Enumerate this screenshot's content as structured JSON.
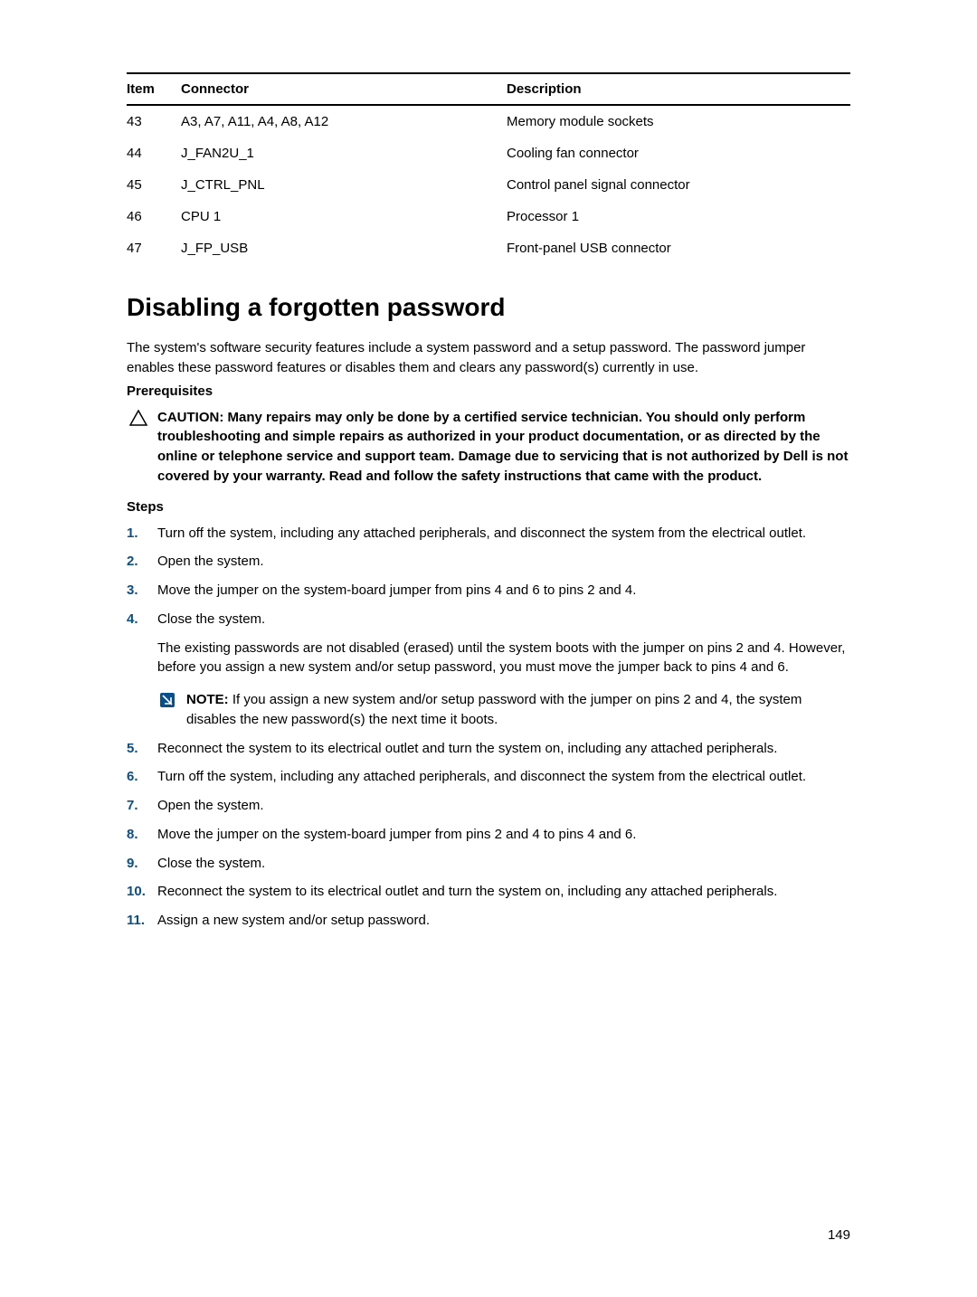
{
  "table": {
    "headers": {
      "item": "Item",
      "connector": "Connector",
      "description": "Description"
    },
    "rows": [
      {
        "item": "43",
        "connector": "A3, A7, A11, A4, A8, A12",
        "description": "Memory module sockets"
      },
      {
        "item": "44",
        "connector": "J_FAN2U_1",
        "description": "Cooling fan connector"
      },
      {
        "item": "45",
        "connector": "J_CTRL_PNL",
        "description": "Control panel signal connector"
      },
      {
        "item": "46",
        "connector": "CPU 1",
        "description": "Processor 1"
      },
      {
        "item": "47",
        "connector": "J_FP_USB",
        "description": "Front-panel USB connector"
      }
    ]
  },
  "heading": "Disabling a forgotten password",
  "intro": "The system's software security features include a system password and a setup password. The password jumper enables these password features or disables them and clears any password(s) currently in use.",
  "prereq_heading": "Prerequisites",
  "caution_label": "CAUTION: ",
  "caution_text": "Many repairs may only be done by a certified service technician. You should only perform troubleshooting and simple repairs as authorized in your product documentation, or as directed by the online or telephone service and support team. Damage due to servicing that is not authorized by Dell is not covered by your warranty. Read and follow the safety instructions that came with the product.",
  "steps_heading": "Steps",
  "steps": {
    "s1": "Turn off the system, including any attached peripherals, and disconnect the system from the electrical outlet.",
    "s2": "Open the system.",
    "s3": "Move the jumper on the system-board jumper from pins 4 and 6 to pins 2 and 4.",
    "s4": "Close the system.",
    "s4_para": "The existing passwords are not disabled (erased) until the system boots with the jumper on pins 2 and 4. However, before you assign a new system and/or setup password, you must move the jumper back to pins 4 and 6.",
    "s4_note_label": "NOTE: ",
    "s4_note_text": "If you assign a new system and/or setup password with the jumper on pins 2 and 4, the system disables the new password(s) the next time it boots.",
    "s5": "Reconnect the system to its electrical outlet and turn the system on, including any attached peripherals.",
    "s6": "Turn off the system, including any attached peripherals, and disconnect the system from the electrical outlet.",
    "s7": "Open the system.",
    "s8": "Move the jumper on the system-board jumper from pins 2 and 4 to pins 4 and 6.",
    "s9": "Close the system.",
    "s10": "Reconnect the system to its electrical outlet and turn the system on, including any attached peripherals.",
    "s11": "Assign a new system and/or setup password."
  },
  "page_number": "149"
}
